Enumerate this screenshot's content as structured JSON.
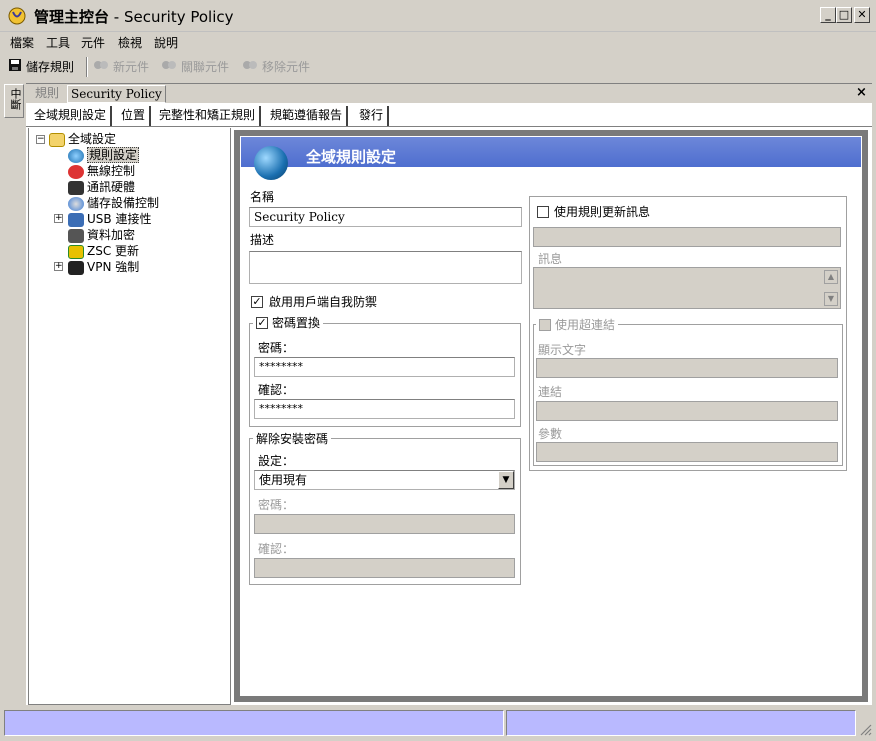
{
  "window": {
    "title_app": "管理主控台",
    "title_doc": "- Security Policy"
  },
  "menu": [
    "檔案",
    "工具",
    "元件",
    "檢視",
    "說明"
  ],
  "toolbar": {
    "save": "儲存規則",
    "new": "新元件",
    "link": "關聯元件",
    "remove": "移除元件"
  },
  "left_tab": "中斷",
  "doc_tabs": {
    "rules": "規則",
    "policy": "Security Policy",
    "close": "×"
  },
  "sub_tabs": [
    "全域規則設定",
    "位置",
    "完整性和矯正規則",
    "規範遵循報告",
    "發行"
  ],
  "tree": {
    "root": "全域設定",
    "items": [
      "規則設定",
      "無線控制",
      "通訊硬體",
      "儲存設備控制",
      "USB 連接性",
      "資料加密",
      "ZSC 更新",
      "VPN 強制"
    ]
  },
  "panel": {
    "title": "全域規則設定",
    "name_label": "名稱",
    "name_value": "Security Policy",
    "desc_label": "描述",
    "desc_value": "",
    "self_protect": "啟用用戶端自我防禦",
    "password_override": "密碼置換",
    "password_label": "密碼：",
    "password_value": "********",
    "confirm_label": "確認：",
    "confirm_value": "********",
    "uninstall_group": "解除安裝密碼",
    "setting_label": "設定：",
    "setting_value": "使用現有",
    "u_password_label": "密碼：",
    "u_confirm_label": "確認：",
    "use_update_msg": "使用規則更新訊息",
    "msg_label": "訊息",
    "use_hyperlink": "使用超連結",
    "display_text_label": "顯示文字",
    "link_label": "連結",
    "params_label": "參數"
  },
  "colors": {
    "header_blue": "#5472d3",
    "status_blue": "#b9b9ff"
  }
}
